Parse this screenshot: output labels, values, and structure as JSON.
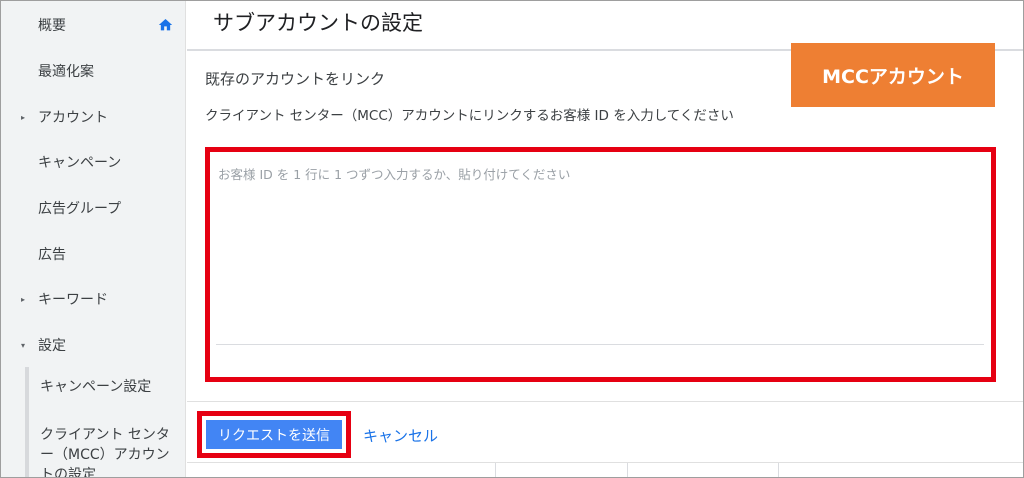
{
  "sidebar": {
    "items": [
      {
        "label": "概要",
        "arrow": ""
      },
      {
        "label": "最適化案",
        "arrow": ""
      },
      {
        "label": "アカウント",
        "arrow": "▸"
      },
      {
        "label": "キャンペーン",
        "arrow": ""
      },
      {
        "label": "広告グループ",
        "arrow": ""
      },
      {
        "label": "広告",
        "arrow": ""
      },
      {
        "label": "キーワード",
        "arrow": "▸"
      },
      {
        "label": "設定",
        "arrow": "▾"
      }
    ],
    "sub_items": [
      {
        "label": "キャンペーン設定"
      },
      {
        "label": "クライアント センター（MCC）アカウントの設定"
      }
    ],
    "home_icon": "home-icon"
  },
  "header": {
    "title": "サブアカウントの設定"
  },
  "link_section": {
    "title": "既存のアカウントをリンク",
    "description": "クライアント センター（MCC）アカウントにリンクするお客様 ID を入力してください",
    "textarea_placeholder": "お客様 ID を 1 行に 1 つずつ入力するか、貼り付けてください",
    "textarea_value": ""
  },
  "badge": {
    "label": "MCCアカウント",
    "color": "#ee7f33"
  },
  "actions": {
    "submit_label": "リクエストを送信",
    "cancel_label": "キャンセル"
  },
  "colors": {
    "primary": "#4285f4",
    "link": "#1a73e8",
    "highlight": "#e60012"
  }
}
